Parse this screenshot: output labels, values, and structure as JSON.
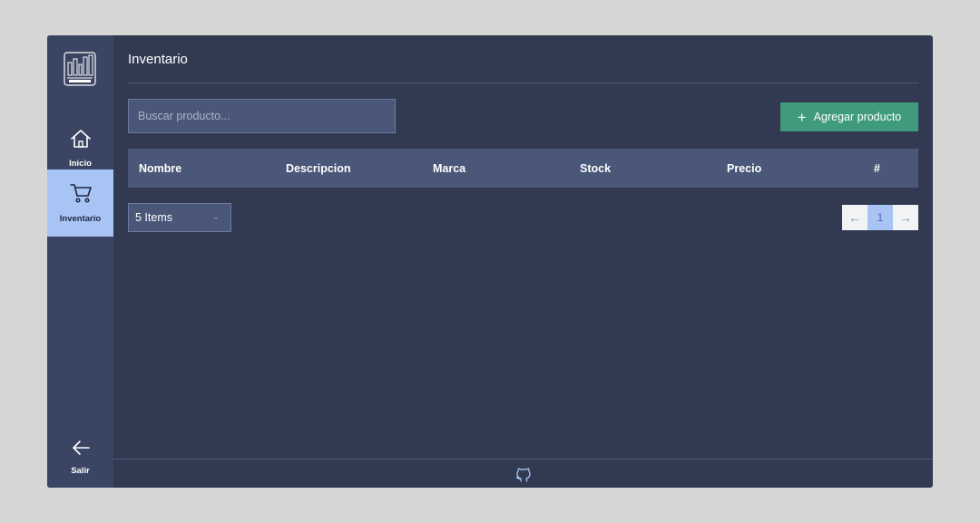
{
  "sidebar": {
    "logo_icon": "stock-control-logo",
    "items": [
      {
        "label": "Inicio",
        "icon": "home-icon"
      },
      {
        "label": "Inventario",
        "icon": "cart-icon"
      },
      {
        "label": "Salir",
        "icon": "arrow-left-icon"
      }
    ]
  },
  "header": {
    "title": "Inventario"
  },
  "search": {
    "placeholder": "Buscar producto..."
  },
  "actions": {
    "add_label": "Agregar producto"
  },
  "table": {
    "columns": [
      "Nombre",
      "Descripcion",
      "Marca",
      "Stock",
      "Precio",
      "#"
    ],
    "rows": []
  },
  "pagination": {
    "page_size": "5 Items",
    "current_page": "1"
  },
  "footer": {
    "icon": "github-icon"
  },
  "colors": {
    "background": "#323a52",
    "sidebar": "#3a4563",
    "active": "#a8c4f5",
    "accent_button": "#3f9b7c",
    "table_header": "#4a5778"
  }
}
